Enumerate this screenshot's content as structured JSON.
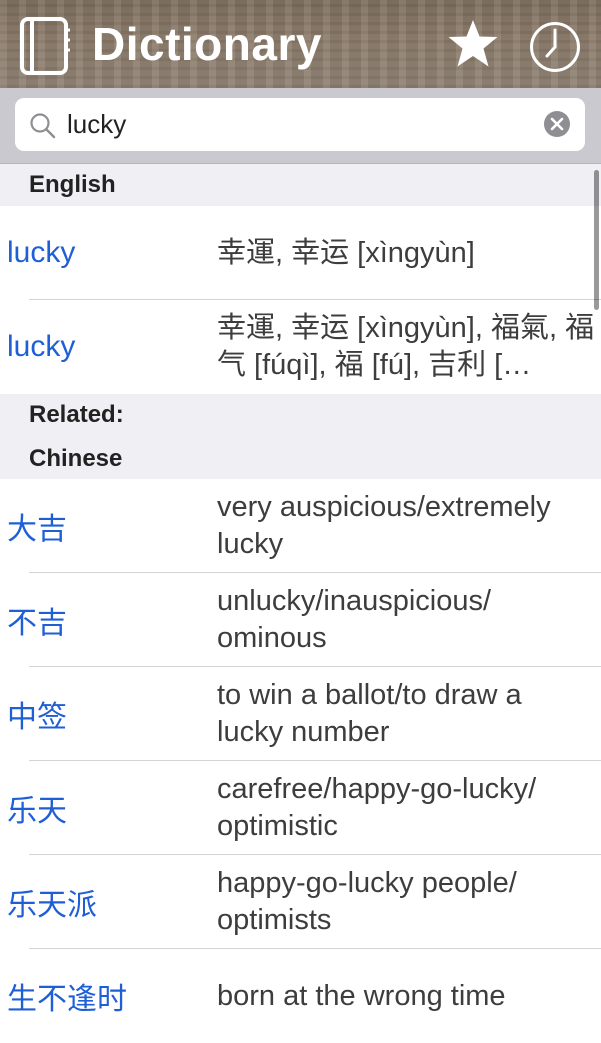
{
  "header": {
    "title": "Dictionary",
    "icons": [
      "book-icon",
      "star-icon",
      "clock-icon"
    ]
  },
  "search": {
    "value": "lucky",
    "placeholder": "Search"
  },
  "sections": {
    "english": "English",
    "related": "Related:",
    "chinese": "Chinese"
  },
  "english_rows": [
    {
      "term": "lucky",
      "definition": "幸運, 幸运 [xìngyùn]"
    },
    {
      "term": "lucky",
      "definition": "幸運, 幸运 [xìngyùn], 福氣, 福气 [fúqì], 福 [fú], 吉利 […"
    }
  ],
  "chinese_rows": [
    {
      "term": "大吉",
      "definition": "very auspicious/extremely lucky"
    },
    {
      "term": "不吉",
      "definition": "unlucky/inauspicious/ ominous"
    },
    {
      "term": "中签",
      "definition": "to win a ballot/to draw a lucky number"
    },
    {
      "term": "乐天",
      "definition": "carefree/happy-go-lucky/ optimistic"
    },
    {
      "term": "乐天派",
      "definition": "happy-go-lucky people/ optimists"
    },
    {
      "term": "生不逢时",
      "definition": "born at the wrong time"
    }
  ],
  "colors": {
    "accent": "#1f5fd6",
    "header_text": "#ffffff",
    "section_bg": "#efeff4"
  }
}
